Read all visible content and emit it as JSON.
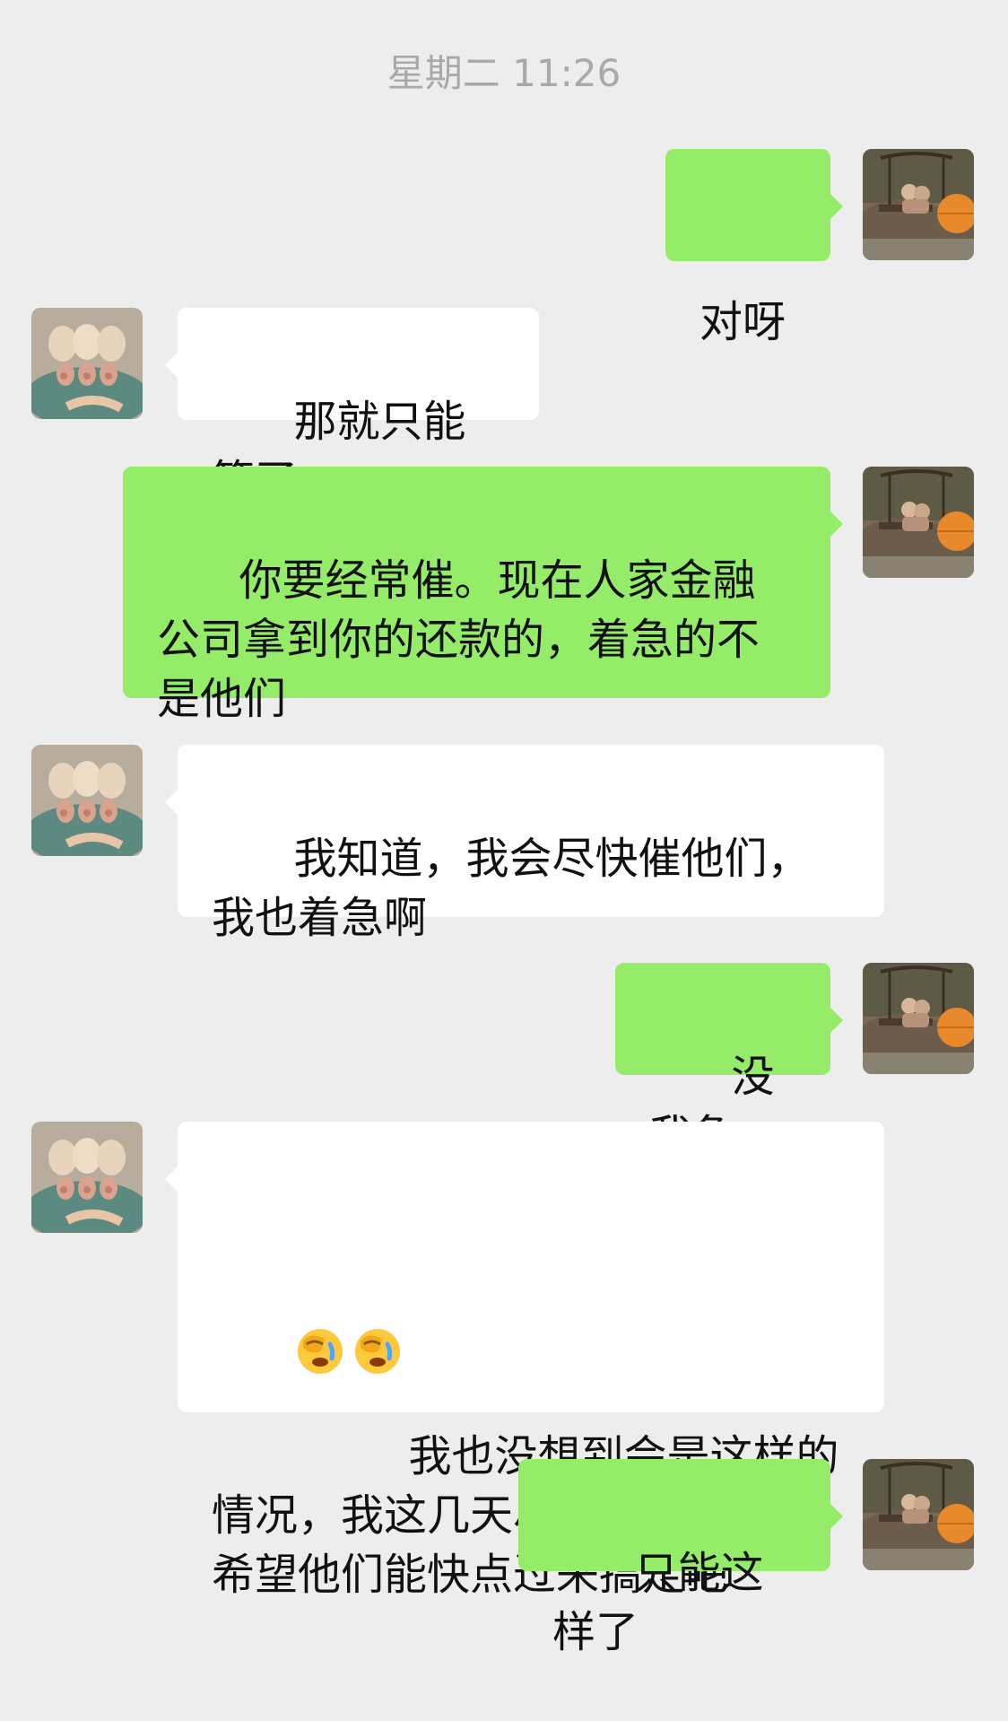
{
  "chat": {
    "timestamp": "星期二 11:26",
    "messages": [
      {
        "direction": "outgoing",
        "text": "对呀",
        "avatar": "photo-avatar-swing"
      },
      {
        "direction": "incoming",
        "text": "那就只能等了",
        "avatar": "photo-avatar-kittens"
      },
      {
        "direction": "outgoing",
        "text": "你要经常催。现在人家金融公司拿到你的还款的，着急的不是他们",
        "avatar": "photo-avatar-swing"
      },
      {
        "direction": "incoming",
        "text": "我知道，我会尽快催他们，我也着急啊",
        "avatar": "photo-avatar-kittens"
      },
      {
        "direction": "outgoing",
        "text": "没我急",
        "avatar": "photo-avatar-swing"
      },
      {
        "direction": "incoming",
        "emoji": [
          "facepalm-emoji",
          "facepalm-emoji"
        ],
        "text": "我也没想到会是这样的情况，我这几天尽量催他们了，希望他们能快点过来搞定吧",
        "avatar": "photo-avatar-kittens"
      },
      {
        "direction": "outgoing",
        "text": "只能这样了",
        "avatar": "photo-avatar-swing"
      }
    ]
  },
  "colors": {
    "background": "#ededed",
    "outgoing_bubble": "#95ec69",
    "incoming_bubble": "#ffffff",
    "timestamp_text": "#a9a9a9",
    "message_text": "#111111"
  }
}
